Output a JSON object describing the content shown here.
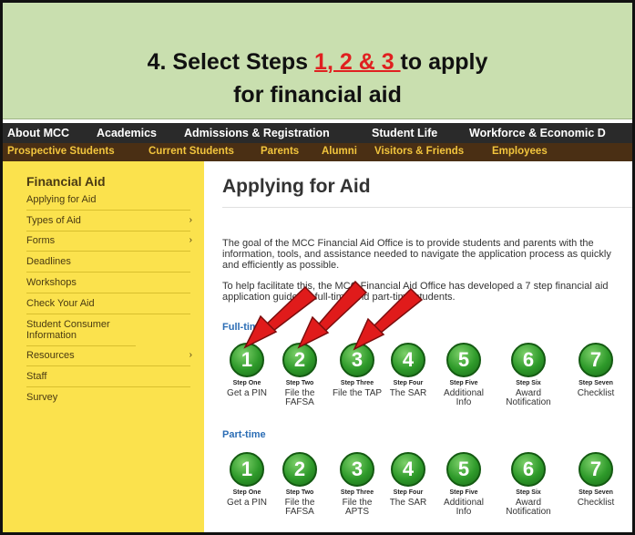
{
  "banner": {
    "line1_prefix": "4. Select Steps ",
    "line1_highlight": "1, 2 & 3 ",
    "line1_suffix": "to apply",
    "line2": "for financial aid"
  },
  "topnav": [
    "About MCC",
    "Academics",
    "Admissions & Registration",
    "Student Life",
    "Workforce & Economic D"
  ],
  "subnav": [
    "Prospective Students",
    "Current Students",
    "Parents",
    "Alumni",
    "Visitors & Friends",
    "Employees"
  ],
  "sidebar": {
    "heading": "Financial Aid",
    "items": [
      {
        "label": "Applying for Aid",
        "chevron": ""
      },
      {
        "label": "Types of Aid",
        "chevron": "›"
      },
      {
        "label": "Forms",
        "chevron": "›"
      },
      {
        "label": "Deadlines",
        "chevron": ""
      },
      {
        "label": "Workshops",
        "chevron": ""
      },
      {
        "label": "Check Your Aid",
        "chevron": ""
      },
      {
        "label": "Student Consumer Information",
        "chevron": ""
      },
      {
        "label": "Resources",
        "chevron": "›"
      },
      {
        "label": "Staff",
        "chevron": ""
      },
      {
        "label": "Survey",
        "chevron": ""
      }
    ]
  },
  "main": {
    "title": "Applying for Aid",
    "para1": "The goal of the MCC Financial Aid Office is to provide students and parents with the information, tools, and assistance needed to navigate the application process as quickly and efficiently as possible.",
    "para2": "To help facilitate this, the MCC Financial Aid Office has developed a 7 step financial aid application guide for full-time and part-time students.",
    "fulltime_label": "Full-time",
    "parttime_label": "Part-time",
    "fulltime_steps": [
      {
        "num": "1",
        "label": "Step One",
        "desc": "Get a PIN"
      },
      {
        "num": "2",
        "label": "Step Two",
        "desc": "File the FAFSA"
      },
      {
        "num": "3",
        "label": "Step Three",
        "desc": "File the TAP"
      },
      {
        "num": "4",
        "label": "Step Four",
        "desc": "The SAR"
      },
      {
        "num": "5",
        "label": "Step Five",
        "desc": "Additional Info"
      },
      {
        "num": "6",
        "label": "Step Six",
        "desc": "Award Notification"
      },
      {
        "num": "7",
        "label": "Step Seven",
        "desc": "Checklist"
      }
    ],
    "parttime_steps": [
      {
        "num": "1",
        "label": "Step One",
        "desc": "Get a PIN"
      },
      {
        "num": "2",
        "label": "Step Two",
        "desc": "File the FAFSA"
      },
      {
        "num": "3",
        "label": "Step Three",
        "desc": "File the APTS"
      },
      {
        "num": "4",
        "label": "Step Four",
        "desc": "The SAR"
      },
      {
        "num": "5",
        "label": "Step Five",
        "desc": "Additional Info"
      },
      {
        "num": "6",
        "label": "Step Six",
        "desc": "Award Notification"
      },
      {
        "num": "7",
        "label": "Step Seven",
        "desc": "Checklist"
      }
    ]
  },
  "colors": {
    "banner_bg": "#c9dfaf",
    "highlight_red": "#e02020",
    "sidebar_bg": "#fbe24d",
    "step_green": "#2e9a2a",
    "arrow_red": "#e01b1b"
  }
}
